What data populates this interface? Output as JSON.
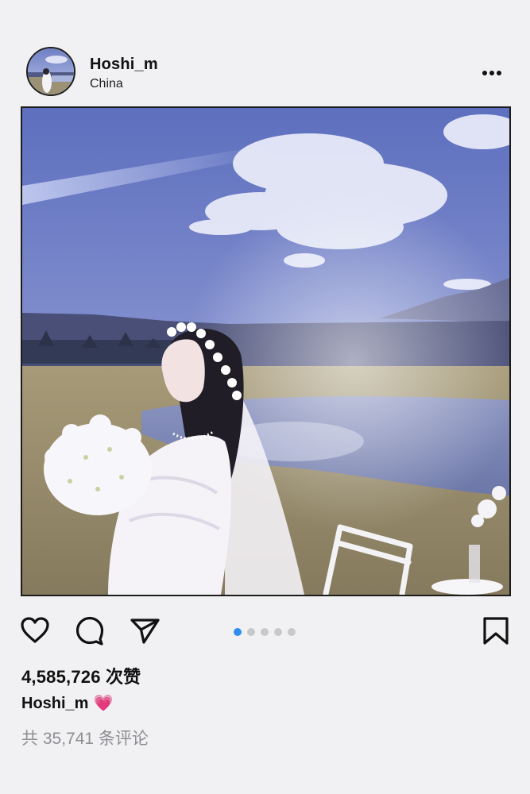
{
  "post": {
    "username": "Hoshi_m",
    "location": "China",
    "likes": "4,585,726 次赞",
    "caption_user": "Hoshi_m",
    "caption_emoji": "💗",
    "comments": "共 35,741 条评论",
    "carousel": {
      "count": 5,
      "active_index": 0
    }
  },
  "icons": {
    "more": "more-horizontal-icon",
    "like": "heart-icon",
    "comment": "comment-bubble-icon",
    "share": "send-arrow-icon",
    "save": "bookmark-icon"
  },
  "colors": {
    "background": "#f1f1f3",
    "active_dot": "#2d8ef0",
    "inactive_dot": "#c9c9cb",
    "muted_text": "#8e8e93",
    "caption_emoji": "#e8498c"
  }
}
